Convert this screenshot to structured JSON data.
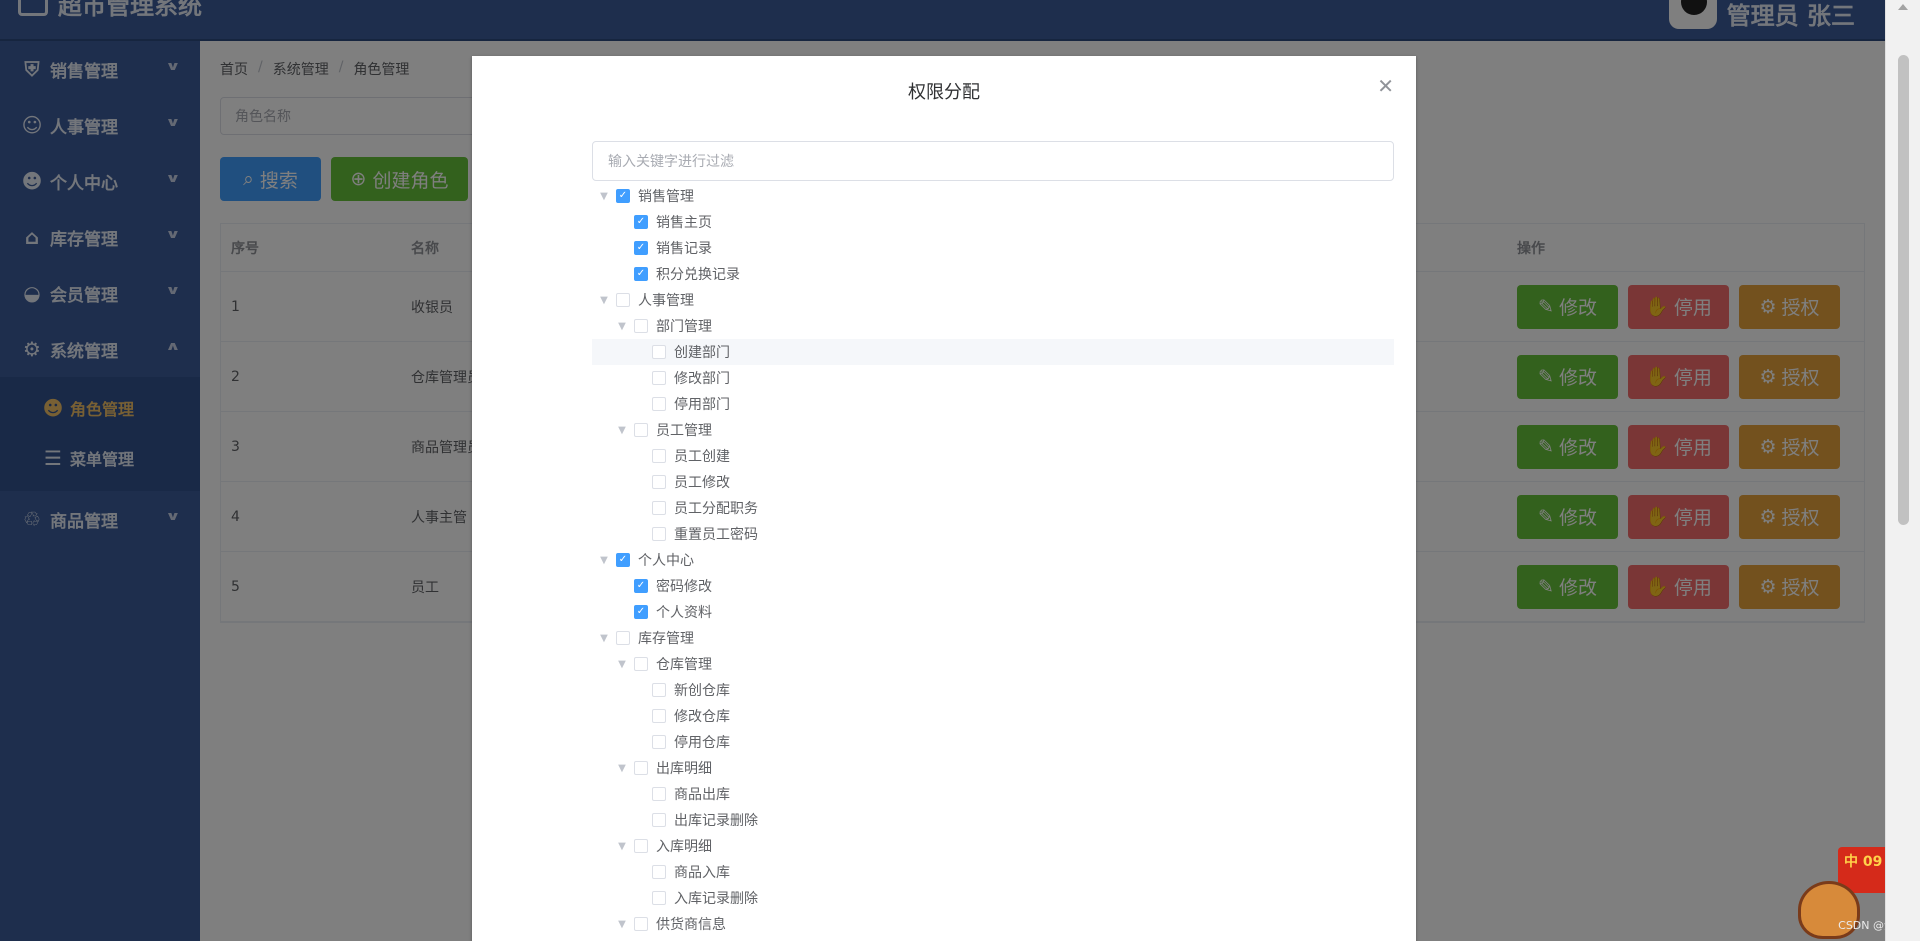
{
  "app": {
    "title": "超市管理系统",
    "user": "管理员 张三"
  },
  "sidebar": {
    "items": [
      {
        "label": "销售管理",
        "icon": "shield-icon"
      },
      {
        "label": "人事管理",
        "icon": "users-icon"
      },
      {
        "label": "个人中心",
        "icon": "user-icon"
      },
      {
        "label": "库存管理",
        "icon": "warehouse-icon"
      },
      {
        "label": "会员管理",
        "icon": "drop-icon"
      },
      {
        "label": "系统管理",
        "icon": "gear-icon"
      },
      {
        "label": "商品管理",
        "icon": "bag-icon"
      }
    ],
    "sub_items": [
      {
        "label": "角色管理",
        "icon": "user-icon",
        "active": true
      },
      {
        "label": "菜单管理",
        "icon": "list-icon",
        "active": false
      }
    ]
  },
  "breadcrumb": [
    "首页",
    "系统管理",
    "角色管理"
  ],
  "search": {
    "placeholder": "角色名称"
  },
  "buttons": {
    "search": "搜索",
    "create": "创建角色"
  },
  "table": {
    "headers": {
      "no": "序号",
      "name": "名称",
      "op": "操作"
    },
    "rows": [
      {
        "no": "1",
        "name": "收银员"
      },
      {
        "no": "2",
        "name": "仓库管理员"
      },
      {
        "no": "3",
        "name": "商品管理员"
      },
      {
        "no": "4",
        "name": "人事主管"
      },
      {
        "no": "5",
        "name": "员工"
      }
    ],
    "actions": {
      "edit": "修改",
      "stop": "停用",
      "auth": "授权"
    }
  },
  "dialog": {
    "title": "权限分配",
    "filter_placeholder": "输入关键字进行过滤",
    "tree": [
      {
        "label": "销售管理",
        "level": 0,
        "expandable": true,
        "checked": true
      },
      {
        "label": "销售主页",
        "level": 1,
        "expandable": false,
        "checked": true
      },
      {
        "label": "销售记录",
        "level": 1,
        "expandable": false,
        "checked": true
      },
      {
        "label": "积分兑换记录",
        "level": 1,
        "expandable": false,
        "checked": true
      },
      {
        "label": "人事管理",
        "level": 0,
        "expandable": true,
        "checked": false
      },
      {
        "label": "部门管理",
        "level": 1,
        "expandable": true,
        "checked": false
      },
      {
        "label": "创建部门",
        "level": 2,
        "expandable": false,
        "checked": false,
        "highlight": true
      },
      {
        "label": "修改部门",
        "level": 2,
        "expandable": false,
        "checked": false
      },
      {
        "label": "停用部门",
        "level": 2,
        "expandable": false,
        "checked": false
      },
      {
        "label": "员工管理",
        "level": 1,
        "expandable": true,
        "checked": false
      },
      {
        "label": "员工创建",
        "level": 2,
        "expandable": false,
        "checked": false
      },
      {
        "label": "员工修改",
        "level": 2,
        "expandable": false,
        "checked": false
      },
      {
        "label": "员工分配职务",
        "level": 2,
        "expandable": false,
        "checked": false
      },
      {
        "label": "重置员工密码",
        "level": 2,
        "expandable": false,
        "checked": false
      },
      {
        "label": "个人中心",
        "level": 0,
        "expandable": true,
        "checked": true
      },
      {
        "label": "密码修改",
        "level": 1,
        "expandable": false,
        "checked": true
      },
      {
        "label": "个人资料",
        "level": 1,
        "expandable": false,
        "checked": true
      },
      {
        "label": "库存管理",
        "level": 0,
        "expandable": true,
        "checked": false
      },
      {
        "label": "仓库管理",
        "level": 1,
        "expandable": true,
        "checked": false
      },
      {
        "label": "新创仓库",
        "level": 2,
        "expandable": false,
        "checked": false
      },
      {
        "label": "修改仓库",
        "level": 2,
        "expandable": false,
        "checked": false
      },
      {
        "label": "停用仓库",
        "level": 2,
        "expandable": false,
        "checked": false
      },
      {
        "label": "出库明细",
        "level": 1,
        "expandable": true,
        "checked": false
      },
      {
        "label": "商品出库",
        "level": 2,
        "expandable": false,
        "checked": false
      },
      {
        "label": "出库记录删除",
        "level": 2,
        "expandable": false,
        "checked": false
      },
      {
        "label": "入库明细",
        "level": 1,
        "expandable": true,
        "checked": false
      },
      {
        "label": "商品入库",
        "level": 2,
        "expandable": false,
        "checked": false
      },
      {
        "label": "入库记录删除",
        "level": 2,
        "expandable": false,
        "checked": false
      },
      {
        "label": "供货商信息",
        "level": 1,
        "expandable": true,
        "checked": false
      }
    ]
  },
  "mascot": {
    "flag_text": "中 09",
    "watermark": "CSDN @余恭"
  },
  "colors": {
    "primary": "#409eff",
    "success": "#67c23a",
    "danger": "#f56c6c",
    "warning": "#e6a23c",
    "sidebar": "#3c5c9b",
    "active": "#f0c068"
  }
}
